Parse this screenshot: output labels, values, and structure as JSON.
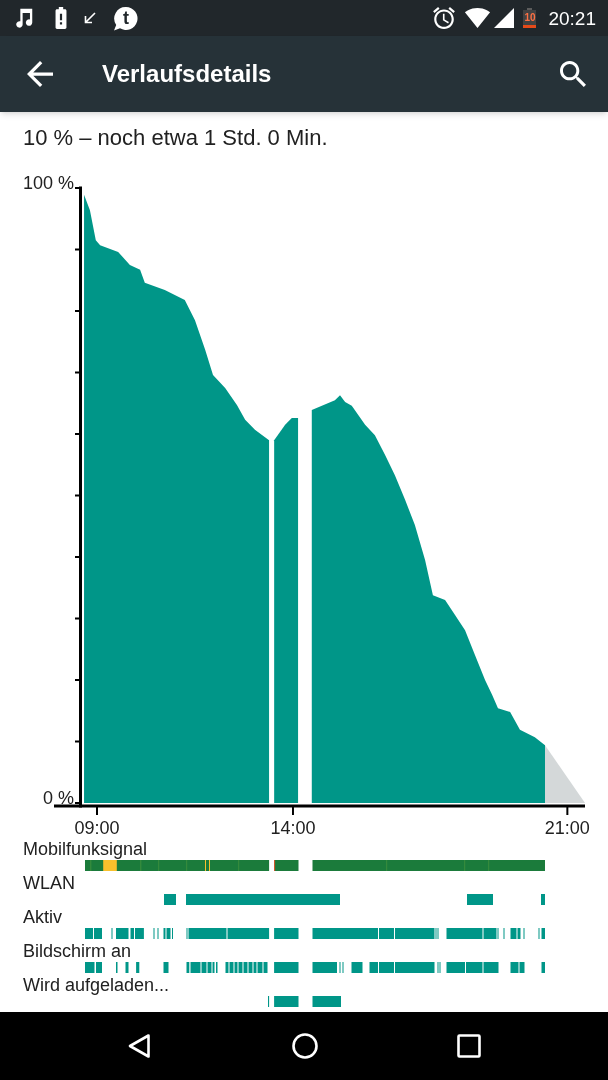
{
  "status_bar": {
    "app_icon_letter": "t",
    "battery_text": "10",
    "time": "20:21"
  },
  "app_bar": {
    "title": "Verlaufsdetails"
  },
  "summary": "10 % – noch etwa 1 Std. 0 Min.",
  "chart": {
    "chart_data": {
      "type": "area",
      "x": [
        8.67,
        8.82,
        8.97,
        9.08,
        9.54,
        9.84,
        10.1,
        10.22,
        10.73,
        11.24,
        11.5,
        11.76,
        11.96,
        12.27,
        12.57,
        12.78,
        13.03,
        13.39,
        13.52,
        13.8,
        13.97,
        14.13,
        14.48,
        15.07,
        15.2,
        15.33,
        15.5,
        15.84,
        16.09,
        16.35,
        16.6,
        16.86,
        17.11,
        17.37,
        17.57,
        17.88,
        18.13,
        18.39,
        18.64,
        18.9,
        19.08,
        19.23,
        19.54,
        19.79,
        20.17,
        20.43,
        21.45
      ],
      "series": [
        {
          "color": "#009688",
          "values": [
            98.9,
            96.4,
            91.5,
            90.7,
            89.6,
            87.5,
            86.7,
            84.6,
            83.4,
            81.8,
            78.5,
            73.7,
            69.6,
            67.5,
            64.7,
            62.3,
            60.7,
            59.0,
            null,
            null,
            null,
            null,
            null,
            null,
            null,
            null,
            null,
            null,
            null,
            null,
            null,
            null,
            null,
            null,
            null,
            null,
            null,
            null,
            null,
            null,
            null,
            null,
            null,
            null,
            null,
            null,
            null
          ]
        },
        {
          "color": "#009688",
          "values": [
            null,
            null,
            null,
            null,
            null,
            null,
            null,
            null,
            null,
            null,
            null,
            null,
            null,
            null,
            null,
            null,
            null,
            null,
            59.0,
            61.5,
            62.6,
            62.6,
            null,
            null,
            null,
            null,
            null,
            null,
            null,
            null,
            null,
            null,
            null,
            null,
            null,
            null,
            null,
            null,
            null,
            null,
            null,
            null,
            null,
            null,
            null,
            null,
            null
          ]
        },
        {
          "color": "#009688",
          "values": [
            null,
            null,
            null,
            null,
            null,
            null,
            null,
            null,
            null,
            null,
            null,
            null,
            null,
            null,
            null,
            null,
            null,
            null,
            null,
            null,
            null,
            null,
            63.9,
            65.5,
            66.3,
            65.2,
            64.6,
            61.5,
            59.8,
            56.6,
            53.3,
            49.3,
            45.2,
            39.5,
            33.8,
            33.0,
            30.6,
            28.1,
            24.1,
            20.0,
            17.6,
            15.4,
            14.8,
            11.9,
            10.7,
            9.4,
            null
          ]
        },
        {
          "color": "#d4d8d9",
          "values": [
            null,
            null,
            null,
            null,
            null,
            null,
            null,
            null,
            null,
            null,
            null,
            null,
            null,
            null,
            null,
            null,
            null,
            null,
            null,
            null,
            null,
            null,
            null,
            null,
            null,
            null,
            null,
            null,
            null,
            null,
            null,
            null,
            null,
            null,
            null,
            null,
            null,
            null,
            null,
            null,
            null,
            null,
            null,
            null,
            null,
            9.4,
            0
          ]
        }
      ],
      "xlim": [
        8.6,
        21.45
      ],
      "ylim": [
        0,
        100
      ],
      "xticks": [
        {
          "value": 9,
          "label": "09:00"
        },
        {
          "value": 14,
          "label": "14:00"
        },
        {
          "value": 21,
          "label": "21:00"
        }
      ],
      "yticks": [
        {
          "value": 0,
          "label": "0 %"
        },
        {
          "value": 100,
          "label": "100 %"
        }
      ]
    }
  },
  "timelines": [
    {
      "label": "Mobilfunksignal",
      "kind": "signal"
    },
    {
      "label": "WLAN",
      "kind": "state"
    },
    {
      "label": "Aktiv",
      "kind": "state"
    },
    {
      "label": "Bildschirm an",
      "kind": "state"
    },
    {
      "label": "Wird aufgeladen...",
      "kind": "state"
    }
  ]
}
